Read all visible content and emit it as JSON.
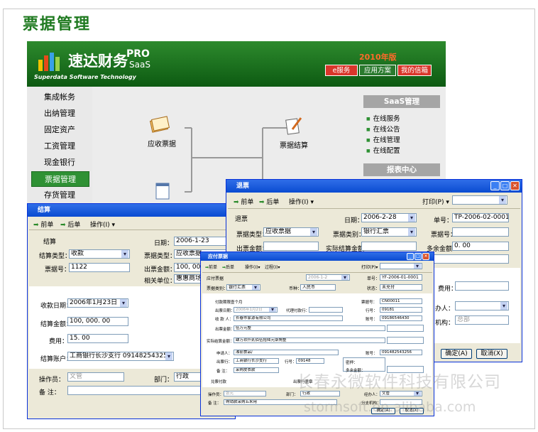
{
  "page_title": "票据管理",
  "app": {
    "brand_cn": "速达财务",
    "brand_pro": "PRO",
    "brand_saas": "SaaS",
    "brand_en": "Superdata Software Technology",
    "year_label": "2010年版",
    "top_buttons": [
      "e服务",
      "应用方案",
      "我的信箱"
    ],
    "nav_items": [
      "集成帐务",
      "出纳管理",
      "固定资产",
      "工资管理",
      "现金银行",
      "票据管理",
      "存货管理"
    ],
    "active_nav": "票据管理",
    "flow_nodes": [
      "应收票据",
      "票据结算"
    ],
    "saas_panel": {
      "title": "SaaS管理",
      "items": [
        "在线服务",
        "在线公告",
        "在线管理",
        "在线配置"
      ]
    },
    "report_panel": {
      "title": "报表中心"
    }
  },
  "win_settle": {
    "title": "结算",
    "toolbar": {
      "prev": "前单",
      "next": "后单",
      "ops": "操作(I)"
    },
    "heading": "结算",
    "date_label": "日期：",
    "date_value": "2006-1-23",
    "settle_type_label": "结算类型：",
    "settle_type_value": "收款",
    "bill_type_label": "票据类型：",
    "bill_type_value": "应收票据",
    "bill_no_label": "票据号：",
    "bill_no_value": "1122",
    "amount_label": "出票金额：",
    "amount_value": "100, 000. 00",
    "unit_label": "相关单位：",
    "unit_value": "惠惠商场",
    "receive_date_label": "收款日期：",
    "receive_date_value": "2006年1月23日",
    "settle_amount_label": "结算金额：",
    "settle_amount_value": "100, 000. 00",
    "fee_label": "费用：",
    "fee_value": "15. 00",
    "account_label": "结算账户：",
    "account_value": "工商银行长沙支行  091482543256",
    "operator_label": "操作员：",
    "operator_value": "文管",
    "dept_label": "部门：",
    "dept_value": "行政",
    "remark_label": "备  注："
  },
  "win_return": {
    "title": "退票",
    "toolbar": {
      "prev": "前单",
      "next": "后单",
      "ops": "操作(I)",
      "print": "打印(P)"
    },
    "heading": "退票",
    "date_label": "日期：",
    "date_value": "2006-2-28",
    "no_label": "单号：",
    "no_value": "TP-2006-02-0001",
    "bill_type_label": "票据类型：",
    "bill_type_value": "应收票据",
    "bill_kind_label": "票据类别：",
    "bill_kind_value": "银行汇票",
    "bill_no_label": "票据号：",
    "amount_label": "出票金额：",
    "actual_label": "实际结算金额：",
    "extra_label": "多余金额：",
    "extra_value": "0. 00",
    "fee_label": "费用：",
    "handler_label": "办人：",
    "org_label": "机构：",
    "org_value": "总部",
    "ok": "确定(A)",
    "cancel": "取消(X)"
  },
  "win_payable": {
    "title": "应付票据",
    "toolbar": {
      "prev": "前单",
      "next": "后单",
      "ops": "操作(I)",
      "process": "过程(I)",
      "print": "打印(P)"
    },
    "heading": "应付票据",
    "date_value": "2006-1-2",
    "no_label": "单号：",
    "no_value": "YF-2006-01-0001",
    "kind_label": "票据类别：",
    "kind_value": "银行汇票",
    "currency_label": "币种：",
    "currency_value": "人民币",
    "status_label": "状态：",
    "status_value": "未兑付",
    "fields": [
      {
        "label": "付款期限",
        "value": "壹个月"
      },
      {
        "label": "出票日期：",
        "value": "2006年1月2日"
      },
      {
        "label": "收 款 人：",
        "value": "长春市家源有限公司"
      },
      {
        "label": "出票金额：",
        "value": "伍万元整"
      },
      {
        "label": "实际结算金额：",
        "value": "肆万玖仟贰佰伍拾陆元柒角整"
      },
      {
        "label": "申请人：",
        "value": "湘丽食品厂"
      },
      {
        "label": "出票行：",
        "value": "工商银行长沙支行"
      },
      {
        "label": "备  注：",
        "value": "采购皮衣款"
      }
    ],
    "right_fields": [
      {
        "label": "票据号：",
        "value": "CN00011"
      },
      {
        "label": "行号：",
        "value": "09181"
      },
      {
        "label": "账号：",
        "value": "09186546430"
      },
      {
        "label": "账号：",
        "value": "091482543256"
      }
    ],
    "agent_bank_label": "代理付款行：",
    "bank_no_label": "行号：",
    "bank_no_value": "09148",
    "seal_label": "密押：",
    "extra_label": "多余金额：",
    "paid_label": "兑票付款",
    "issuer_label": "出票行盖章",
    "operator_label": "操作员：",
    "operator_value": "张元",
    "dept_label": "部门：",
    "dept_value": "行政",
    "handler_label": "经办人：",
    "handler_value": "文管",
    "remark2_label": "备  注：",
    "remark2_value": "购销款采购五米用",
    "branch_label": "分支机构：",
    "ok": "确定(A)",
    "cancel": "取消(X)"
  },
  "watermark": {
    "line1": "长春永微软件科技有限公司",
    "line2": "stormsoft.en.alibaba.com"
  }
}
